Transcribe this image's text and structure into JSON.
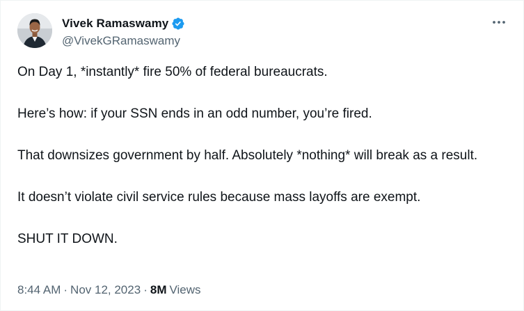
{
  "author": {
    "display_name": "Vivek Ramaswamy",
    "handle": "@VivekGRamaswamy"
  },
  "tweet": {
    "paragraphs": [
      "On Day 1, *instantly* fire 50% of federal bureaucrats.",
      "Here’s how: if your SSN ends in an odd number, you’re fired.",
      "That downsizes government by half. Absolutely *nothing* will break as a result.",
      "It doesn’t violate civil service rules because mass layoffs are exempt.",
      "SHUT IT DOWN."
    ]
  },
  "meta": {
    "time": "8:44 AM",
    "separator": "·",
    "date": "Nov 12, 2023",
    "views_count": "8M",
    "views_label": "Views"
  },
  "icons": {
    "verified": "verified-badge-icon",
    "more": "more-options-icon"
  },
  "colors": {
    "verified_blue": "#1d9bf0",
    "text_primary": "#0f1419",
    "text_secondary": "#536471"
  }
}
